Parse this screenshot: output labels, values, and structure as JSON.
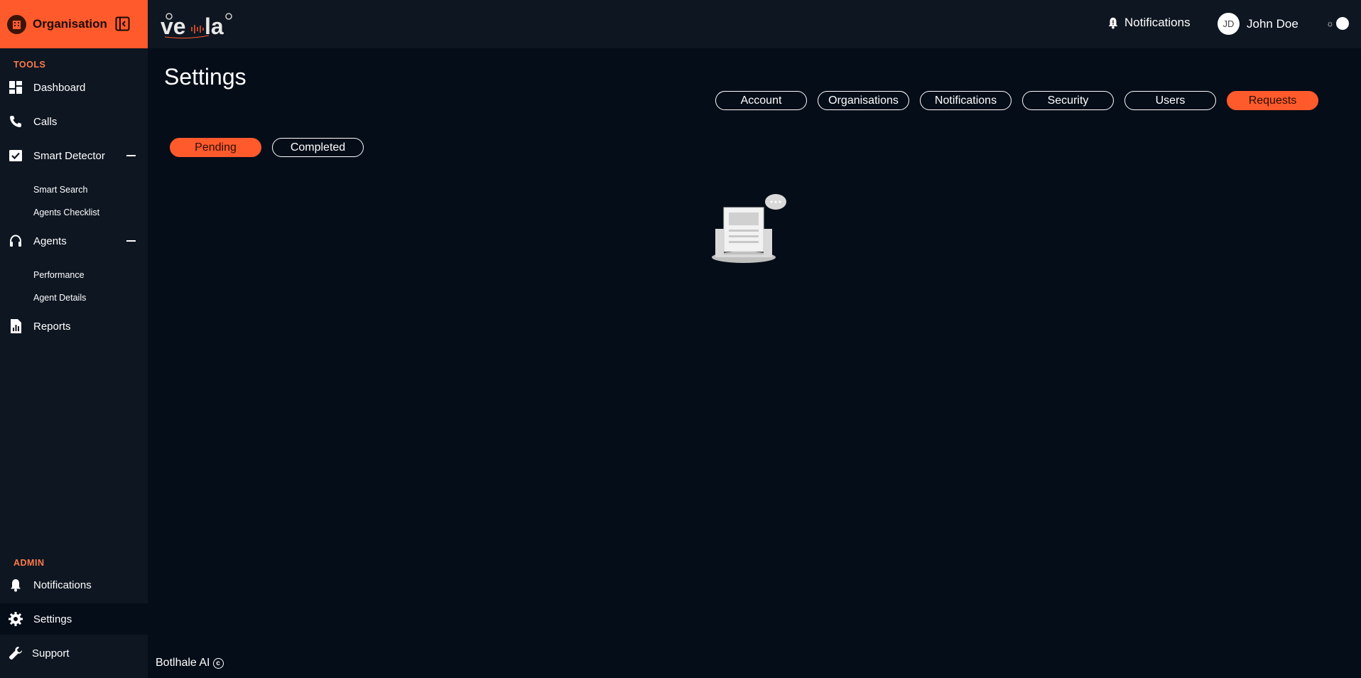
{
  "sidebar": {
    "org_name": "Organisation",
    "tools_label": "TOOLS",
    "admin_label": "ADMIN",
    "items": {
      "dashboard": "Dashboard",
      "calls": "Calls",
      "smart_detector": "Smart Detector",
      "smart_search": "Smart Search",
      "agents_checklist": "Agents Checklist",
      "agents": "Agents",
      "performance": "Performance",
      "agent_details": "Agent Details",
      "reports": "Reports",
      "notifications": "Notifications",
      "settings": "Settings",
      "support": "Support"
    }
  },
  "header": {
    "notifications_label": "Notifications",
    "user_initials": "JD",
    "user_name": "John Doe",
    "theme_icon": "sun-icon"
  },
  "main": {
    "title": "Settings",
    "tabs": [
      "Account",
      "Organisations",
      "Notifications",
      "Security",
      "Users",
      "Requests"
    ],
    "active_tab": "Requests",
    "subtabs": [
      "Pending",
      "Completed"
    ],
    "active_subtab": "Pending"
  },
  "footer": {
    "text": "Botlhale AI"
  },
  "colors": {
    "accent": "#ff5a2c",
    "sidebar_bg": "#0e1621",
    "page_bg": "#050d18"
  }
}
